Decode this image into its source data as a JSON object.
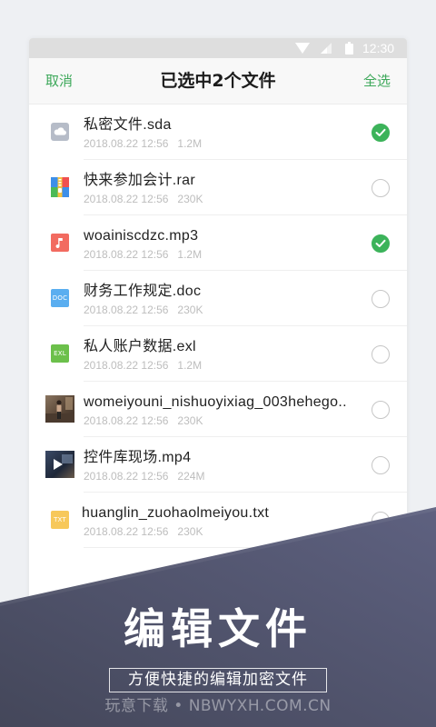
{
  "status_bar": {
    "time": "12:30",
    "icons": [
      "wifi-icon",
      "signal-icon",
      "battery-icon"
    ]
  },
  "header": {
    "cancel_label": "取消",
    "title": "已选中2个文件",
    "select_all_label": "全选"
  },
  "files": [
    {
      "name": "私密文件.sda",
      "date": "2018.08.22 12:56",
      "size": "1.2M",
      "icon": "cloud-file-icon",
      "checked": true
    },
    {
      "name": "快来参加会计.rar",
      "date": "2018.08.22 12:56",
      "size": "230K",
      "icon": "rar-archive-icon",
      "checked": false
    },
    {
      "name": "woainiscdzc.mp3",
      "date": "2018.08.22 12:56",
      "size": "1.2M",
      "icon": "music-note-icon",
      "checked": true
    },
    {
      "name": "财务工作规定.doc",
      "date": "2018.08.22 12:56",
      "size": "230K",
      "icon": "doc-file-icon",
      "icon_label": "DOC",
      "checked": false
    },
    {
      "name": "私人账户数据.exl",
      "date": "2018.08.22 12:56",
      "size": "1.2M",
      "icon": "excel-file-icon",
      "icon_label": "EXL",
      "checked": false
    },
    {
      "name": "womeiyouni_nishuoyixiag_003hehego..",
      "date": "2018.08.22 12:56",
      "size": "230K",
      "icon": "photo-thumbnail",
      "checked": false
    },
    {
      "name": "控件库现场.mp4",
      "date": "2018.08.22 12:56",
      "size": "224M",
      "icon": "video-thumbnail",
      "checked": false
    },
    {
      "name": "huanglin_zuohaolmeiyou.txt",
      "date": "2018.08.22 12:56",
      "size": "230K",
      "icon": "txt-file-icon",
      "icon_label": "TXT",
      "checked": false
    }
  ],
  "banner": {
    "headline": "编辑文件",
    "subtitle": "方便快捷的编辑加密文件",
    "watermark": "玩意下载 • NBWYXH.COM.CN"
  },
  "colors": {
    "accent": "#3cb35a",
    "action": "#3da85a",
    "banner_dark": "#44475a",
    "banner_light": "#5e6180"
  }
}
